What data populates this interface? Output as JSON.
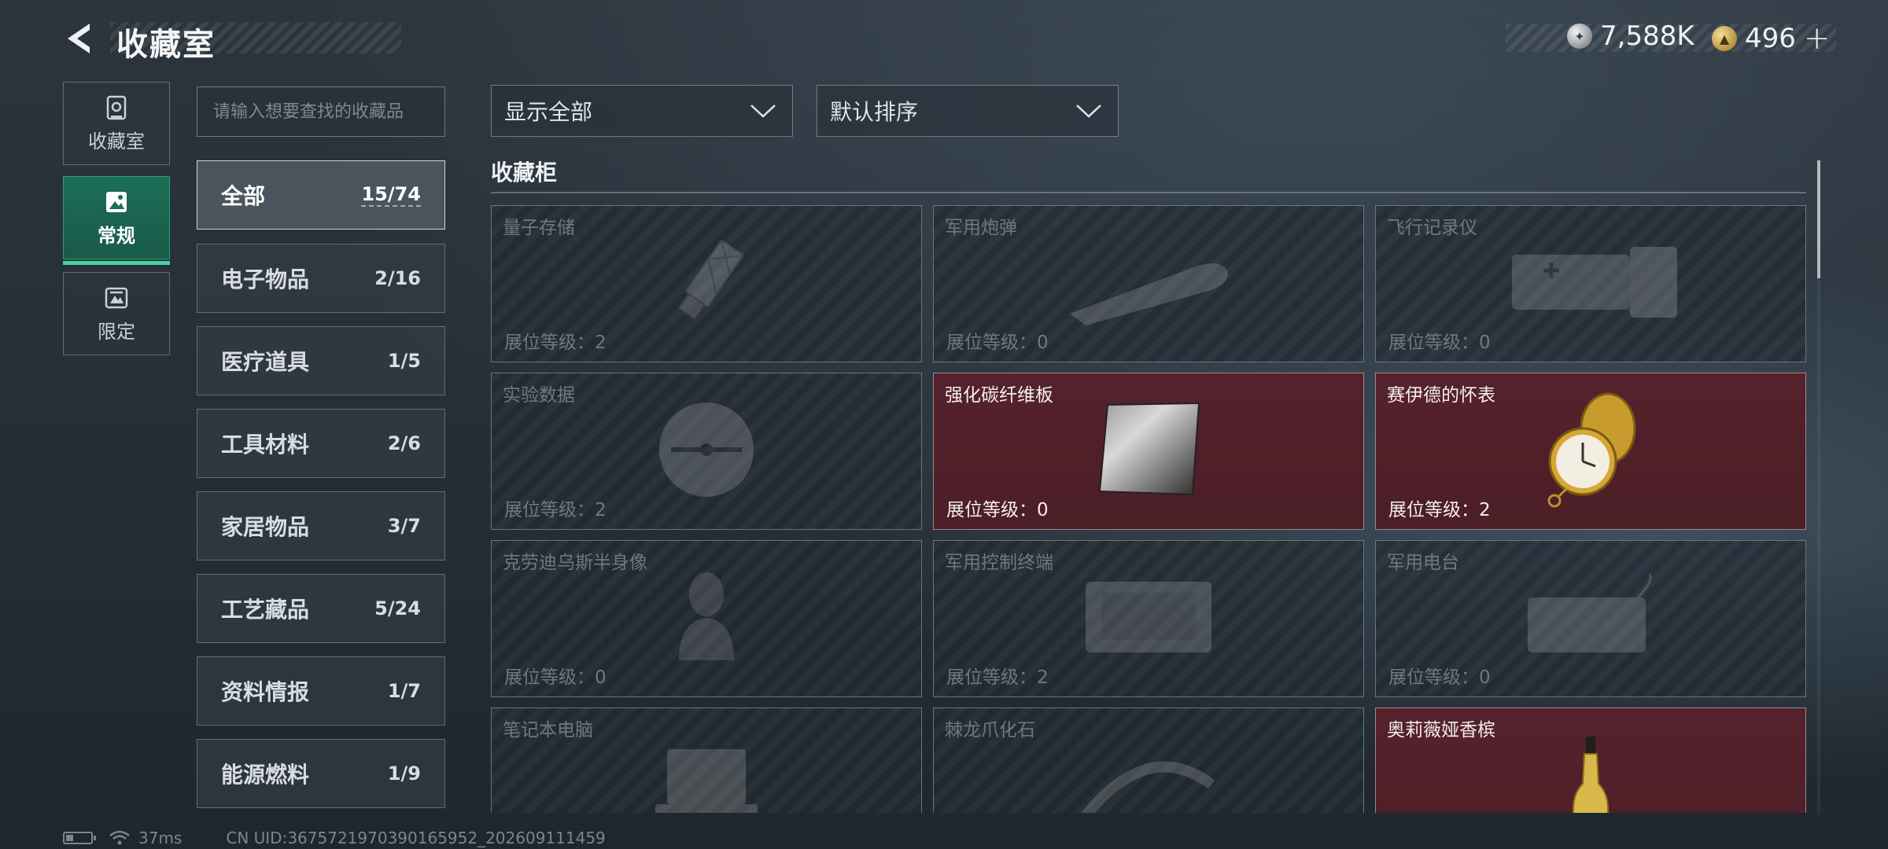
{
  "header": {
    "title": "收藏室",
    "currency_silver": "7,588K",
    "currency_gold": "496",
    "plus_label": "+"
  },
  "nav": [
    {
      "label": "收藏室",
      "icon": "vault-icon",
      "active": false
    },
    {
      "label": "常规",
      "icon": "picture-icon",
      "active": true
    },
    {
      "label": "限定",
      "icon": "limited-icon",
      "active": false
    }
  ],
  "search": {
    "placeholder": "请输入想要查找的收藏品"
  },
  "categories": [
    {
      "name": "全部",
      "count": "15/74",
      "active": true
    },
    {
      "name": "电子物品",
      "count": "2/16"
    },
    {
      "name": "医疗道具",
      "count": "1/5"
    },
    {
      "name": "工具材料",
      "count": "2/6"
    },
    {
      "name": "家居物品",
      "count": "3/7"
    },
    {
      "name": "工艺藏品",
      "count": "5/24"
    },
    {
      "name": "资料情报",
      "count": "1/7"
    },
    {
      "name": "能源燃料",
      "count": "1/9"
    }
  ],
  "filters": {
    "show": "显示全部",
    "sort": "默认排序"
  },
  "section": {
    "title": "收藏柜"
  },
  "level_prefix": "展位等级：",
  "items": [
    {
      "name": "量子存储",
      "level": "2",
      "owned": true,
      "art": "usb"
    },
    {
      "name": "军用炮弹",
      "level": "0",
      "owned": false,
      "art": "shell"
    },
    {
      "name": "飞行记录仪",
      "level": "0",
      "owned": false,
      "art": "box"
    },
    {
      "name": "实验数据",
      "level": "2",
      "owned": false,
      "art": "disc"
    },
    {
      "name": "强化碳纤维板",
      "level": "0",
      "owned": true,
      "art": "plate"
    },
    {
      "name": "赛伊德的怀表",
      "level": "2",
      "owned": true,
      "art": "watch"
    },
    {
      "name": "克劳迪乌斯半身像",
      "level": "0",
      "owned": false,
      "art": "bust"
    },
    {
      "name": "军用控制终端",
      "level": "2",
      "owned": false,
      "art": "terminal"
    },
    {
      "name": "军用电台",
      "level": "0",
      "owned": false,
      "art": "radio"
    },
    {
      "name": "笔记本电脑",
      "level": "",
      "owned": false,
      "art": "laptop"
    },
    {
      "name": "棘龙爪化石",
      "level": "",
      "owned": false,
      "art": "fossil"
    },
    {
      "name": "奥莉薇娅香槟",
      "level": "",
      "owned": true,
      "art": "bottle"
    }
  ],
  "status": {
    "ping": "37ms",
    "uid": "CN UID:3675721970390165952_202609111459"
  },
  "colors": {
    "owned_bg": "#4f2029",
    "active_nav": "#1d6e57",
    "accent_green": "#44d29f"
  }
}
